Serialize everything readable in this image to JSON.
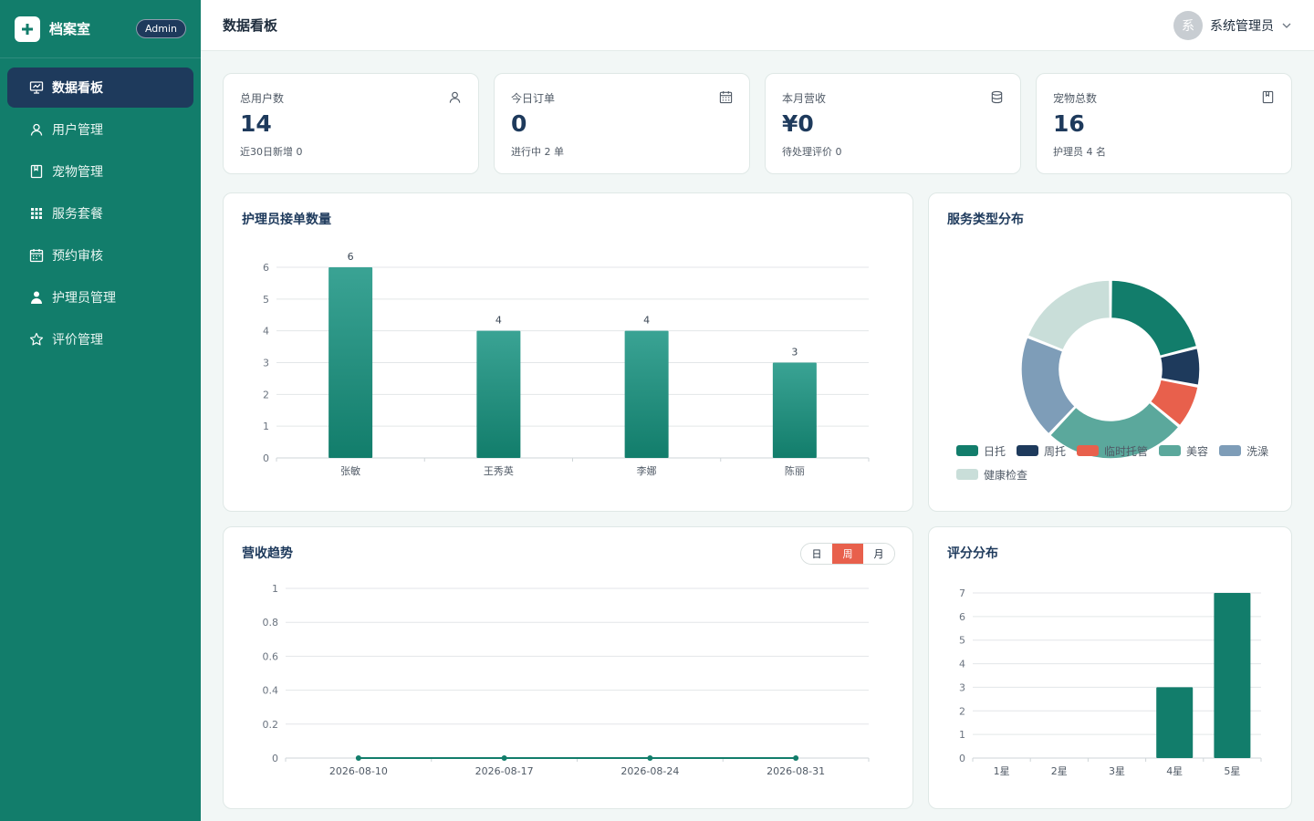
{
  "sidebar": {
    "brand_name": "档案室",
    "badge": "Admin",
    "items": [
      {
        "label": "数据看板",
        "icon": "dashboard-icon",
        "active": true
      },
      {
        "label": "用户管理",
        "icon": "user-icon"
      },
      {
        "label": "宠物管理",
        "icon": "book-icon"
      },
      {
        "label": "服务套餐",
        "icon": "grid-icon"
      },
      {
        "label": "预约审核",
        "icon": "calendar-icon"
      },
      {
        "label": "护理员管理",
        "icon": "person-icon"
      },
      {
        "label": "评价管理",
        "icon": "star-icon"
      }
    ]
  },
  "header": {
    "title": "数据看板",
    "avatar_text": "系",
    "user_name": "系统管理员"
  },
  "stats": [
    {
      "label": "总用户数",
      "value": "14",
      "sub": "近30日新增 0",
      "icon": "user-icon"
    },
    {
      "label": "今日订单",
      "value": "0",
      "sub": "进行中 2 单",
      "icon": "calendar-icon"
    },
    {
      "label": "本月营收",
      "value": "¥0",
      "sub": "待处理评价 0",
      "icon": "database-icon"
    },
    {
      "label": "宠物总数",
      "value": "16",
      "sub": "护理员 4 名",
      "icon": "book-icon"
    }
  ],
  "colors": {
    "primary": "#127d6b",
    "navy": "#1e3a5c",
    "accent": "#e8604c",
    "bar_top": "#3aa394",
    "bar_bottom": "#127d6b"
  },
  "charts": {
    "caregiver": {
      "title": "护理员接单数量",
      "chart_data": {
        "type": "bar",
        "categories": [
          "张敏",
          "王秀英",
          "李娜",
          "陈丽"
        ],
        "values": [
          6,
          4,
          4,
          3
        ],
        "yticks": [
          0,
          1,
          2,
          3,
          4,
          5,
          6
        ],
        "ylim": [
          0,
          6
        ]
      }
    },
    "service": {
      "title": "服务类型分布",
      "chart_data": {
        "type": "pie",
        "labels": [
          "日托",
          "周托",
          "临时托管",
          "美容",
          "洗澡",
          "健康检查"
        ],
        "values": [
          21,
          7,
          8,
          26,
          19,
          19
        ],
        "colors": [
          "#127d6b",
          "#1e3a5c",
          "#e8604c",
          "#5ba89c",
          "#7e9db8",
          "#c9ded9"
        ]
      }
    },
    "revenue": {
      "title": "营收趋势",
      "periods": [
        "日",
        "周",
        "月"
      ],
      "active_period": "周",
      "chart_data": {
        "type": "line",
        "x": [
          "2026-08-10",
          "2026-08-17",
          "2026-08-24",
          "2026-08-31"
        ],
        "values": [
          0,
          0,
          0,
          0
        ],
        "yticks": [
          "0",
          "0.2",
          "0.4",
          "0.6",
          "0.8",
          "1"
        ],
        "ylim": [
          0,
          1
        ]
      }
    },
    "rating": {
      "title": "评分分布",
      "chart_data": {
        "type": "bar",
        "categories": [
          "1星",
          "2星",
          "3星",
          "4星",
          "5星"
        ],
        "values": [
          0,
          0,
          0,
          3,
          7
        ],
        "yticks": [
          0,
          1,
          2,
          3,
          4,
          5,
          6,
          7
        ],
        "ylim": [
          0,
          7
        ]
      }
    }
  }
}
